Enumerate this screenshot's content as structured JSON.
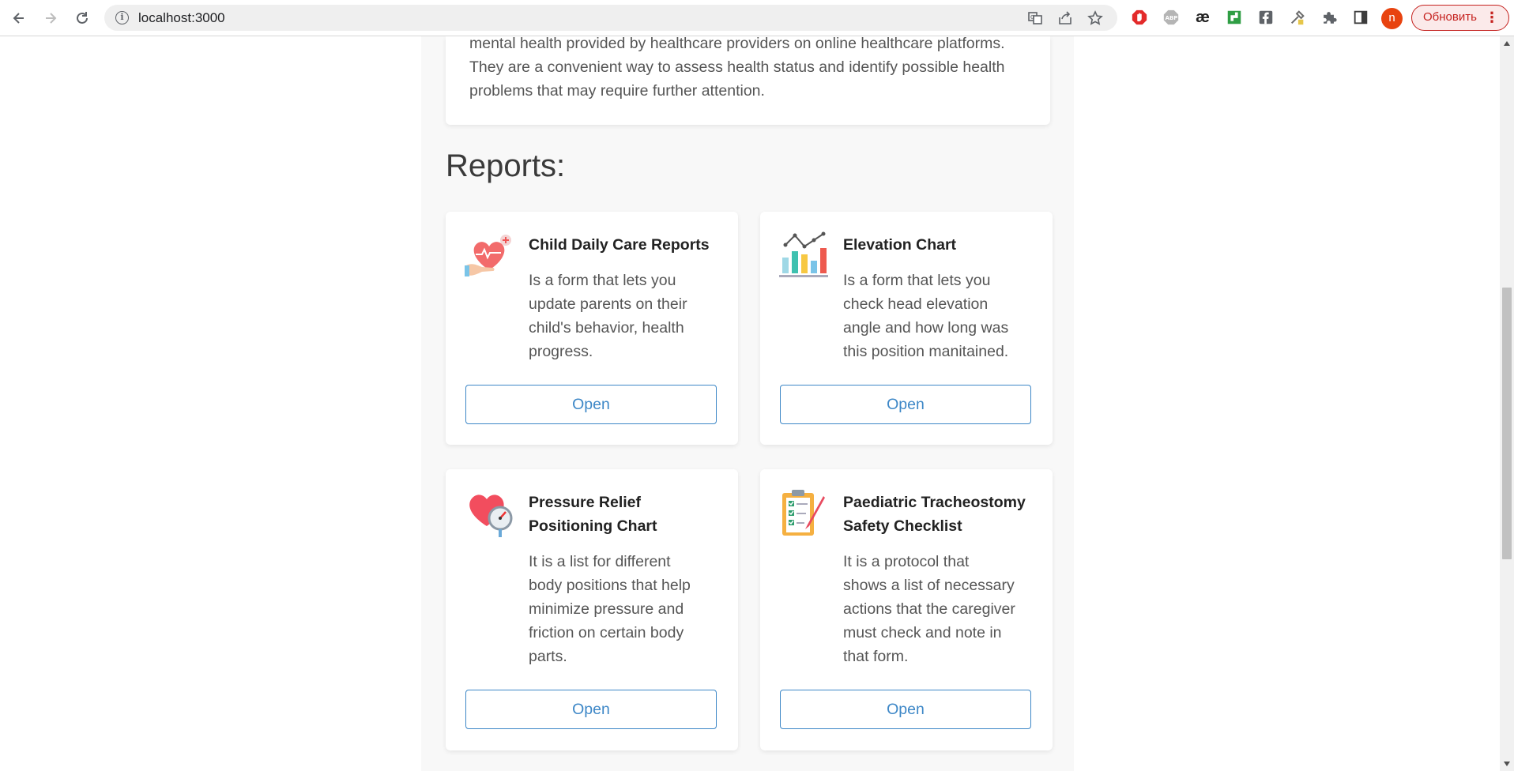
{
  "browser": {
    "url": "localhost:3000",
    "avatar_letter": "n",
    "update_label": "Обновить",
    "extensions": [
      "adblock-stop-icon",
      "abp-icon",
      "ae-icon",
      "green-ext-icon",
      "facebook-icon",
      "eyedropper-icon",
      "puzzle-icon",
      "side-panel-icon"
    ],
    "abp_label": "ABP",
    "ae_label": "æ"
  },
  "intro": {
    "text": "mental health provided by healthcare providers on online healthcare platforms. They are a convenient way to assess health status and identify possible health problems that may require further attention."
  },
  "reports": {
    "title": "Reports:",
    "cards": [
      {
        "title": "Child Daily Care Reports",
        "description": "Is a form that lets you update parents on their child's behavior, health progress.",
        "button": "Open",
        "icon": "heart-hand-icon"
      },
      {
        "title": "Elevation Chart",
        "description": "Is a form that lets you check head elevation angle and how long was this position manitained.",
        "button": "Open",
        "icon": "bar-chart-icon"
      },
      {
        "title": "Pressure Relief Positioning Chart",
        "description": "It is a list for different body positions that help minimize pressure and friction on certain body parts.",
        "button": "Open",
        "icon": "heart-gauge-icon"
      },
      {
        "title": "Paediatric Tracheostomy Safety Checklist",
        "description": "It is a protocol that shows a list of necessary actions that the caregiver must check and note in that form.",
        "button": "Open",
        "icon": "clipboard-checklist-icon"
      }
    ]
  },
  "colors": {
    "accent": "#3d87c7",
    "page_bg": "#f8f8f8",
    "card_bg": "#ffffff",
    "update_red": "#c5221f"
  }
}
